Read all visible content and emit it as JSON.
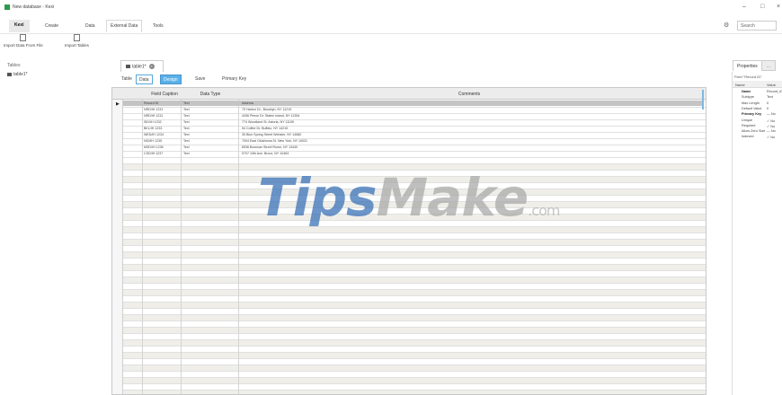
{
  "window": {
    "title": "New database - Kexi",
    "minimize": "–",
    "maximize": "□",
    "close": "×"
  },
  "ribbon": {
    "tabs": [
      {
        "label": "Kexi"
      },
      {
        "label": "Create"
      },
      {
        "label": "Data"
      },
      {
        "label": "External Data"
      },
      {
        "label": "Tools"
      }
    ],
    "search": "Search",
    "buttons": [
      {
        "label": "Import Data From File"
      },
      {
        "label": "Import Tables"
      }
    ]
  },
  "nav": {
    "title": "Tables",
    "items": [
      {
        "label": "table1*"
      }
    ]
  },
  "document": {
    "tab_label": "table1*",
    "toolbar": {
      "view_label": "Table",
      "data": "Data",
      "design": "Design",
      "save": "Save",
      "primary_key": "Primary Key"
    }
  },
  "grid": {
    "headers": {
      "caption": "Field Caption",
      "type": "Data Type",
      "comments": "Comments"
    },
    "rows": [
      {
        "caption": "Record ID",
        "type": "Text",
        "comments": "Address"
      },
      {
        "caption": "NRD/IH 1231",
        "type": "Text",
        "comments": "70 Harbor Dr., Brooklyn, NY 11219"
      },
      {
        "caption": "NRD/IH 1231",
        "type": "Text",
        "comments": "4436 Pierce Dr. Staten Island, NY 11354"
      },
      {
        "caption": "SID/IH 1232",
        "type": "Text",
        "comments": "774 Woodland St. Astoria, NY 11105"
      },
      {
        "caption": "BKL/IH 1233",
        "type": "Text",
        "comments": "54 Coffee Dr. Buffalo, NY 14215"
      },
      {
        "caption": "WED/IH 1234",
        "type": "Text",
        "comments": "35 Blue Spring Street Webster, NY 14580"
      },
      {
        "caption": "NIO/IH 1235",
        "type": "Text",
        "comments": "7004 East Oklahoma St. New York, NY 10031"
      },
      {
        "caption": "MSD/IH 1236",
        "type": "Text",
        "comments": "8936 Bowman Street Rome, NY 13440"
      },
      {
        "caption": "CSD/IH 1237",
        "type": "Text",
        "comments": "9707 10th Ave. Bronx, NY 10463"
      }
    ]
  },
  "watermark": {
    "part1": "Tips",
    "part2": "Make",
    "part3": ".com"
  },
  "properties": {
    "tab": "Properties",
    "field_label": "Field \"Record ID\"",
    "headers": {
      "name": "Name",
      "value": "Value"
    },
    "rows": [
      {
        "key": "Name",
        "value": "Record_ID",
        "bold": true
      },
      {
        "key": "Subtype",
        "value": "Text"
      },
      {
        "key": "Max Length",
        "value": "0"
      },
      {
        "key": "Default Value",
        "value": "0"
      },
      {
        "key": "Primary Key",
        "value": "— No",
        "bold": true
      },
      {
        "key": "Unique",
        "value": "✓ No"
      },
      {
        "key": "Required",
        "value": "✓ No"
      },
      {
        "key": "Allow Zero Size",
        "value": "— No"
      },
      {
        "key": "Indexed",
        "value": "✓ No"
      }
    ]
  }
}
